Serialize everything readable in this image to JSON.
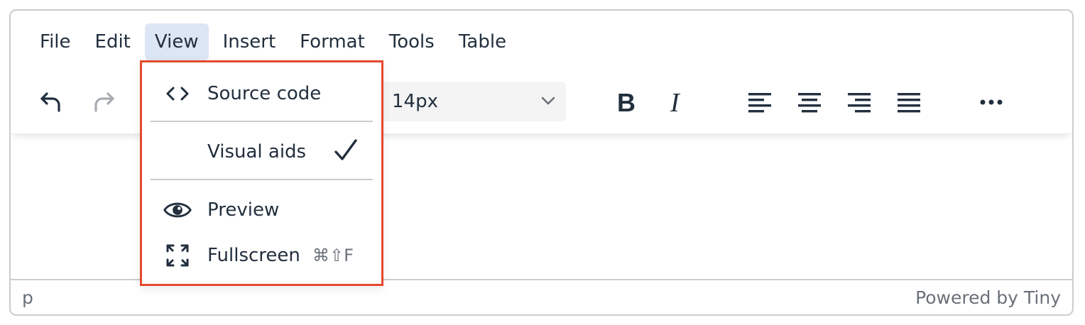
{
  "menubar": {
    "items": [
      {
        "label": "File"
      },
      {
        "label": "Edit"
      },
      {
        "label": "View",
        "active": true
      },
      {
        "label": "Insert"
      },
      {
        "label": "Format"
      },
      {
        "label": "Tools"
      },
      {
        "label": "Table"
      }
    ]
  },
  "toolbar": {
    "font_size_value": "14px",
    "buttons": [
      "undo-icon",
      "redo-icon",
      "bold-icon",
      "italic-icon",
      "align-left-icon",
      "align-center-icon",
      "align-right-icon",
      "justify-icon",
      "more-icon"
    ]
  },
  "view_menu": {
    "items": [
      {
        "label": "Source code",
        "icon": "source-code-icon"
      },
      {
        "label": "Visual aids",
        "checked": true
      },
      {
        "label": "Preview",
        "icon": "eye-icon"
      },
      {
        "label": "Fullscreen",
        "icon": "fullscreen-icon",
        "shortcut": "⌘⇧F"
      }
    ],
    "highlight_color": "#e5492e"
  },
  "statusbar": {
    "path": "p",
    "branding": "Powered by Tiny"
  },
  "colors": {
    "text": "#222f3e",
    "menu_active_bg": "#dde6f5",
    "muted": "#6a7079"
  }
}
